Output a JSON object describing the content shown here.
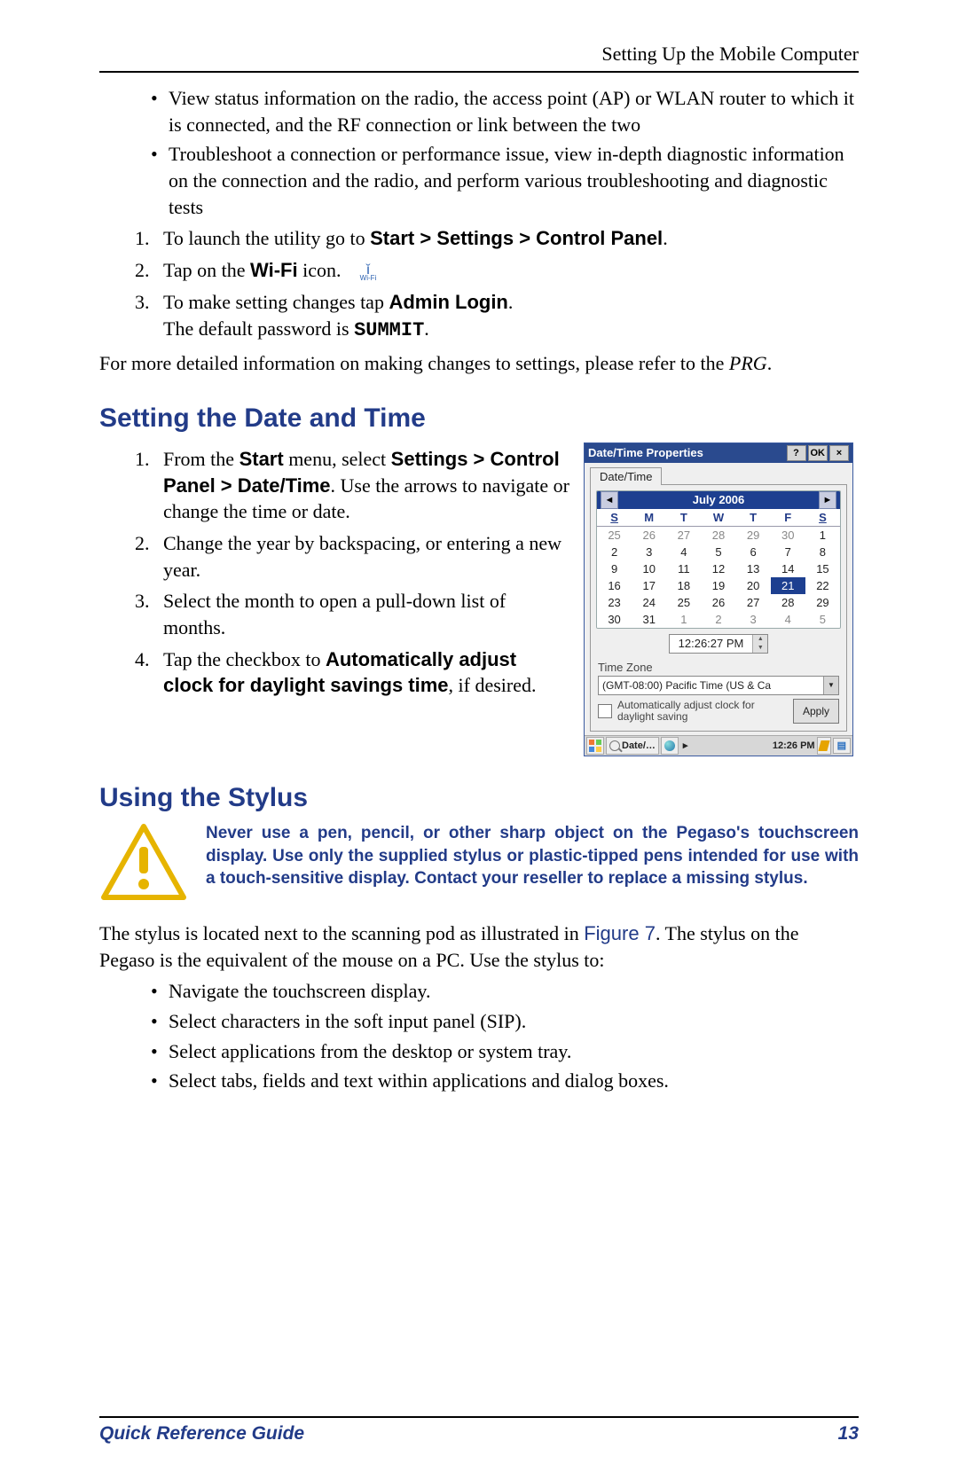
{
  "header": {
    "title": "Setting Up the Mobile Computer"
  },
  "intro_bullets": [
    "View status information on the radio, the access point (AP) or WLAN router to which it is connected, and the RF connection or link between the two",
    "Troubleshoot a connection or performance issue, view in-depth diagnostic information on the connection and the radio, and perform various troubleshooting and diagnostic tests"
  ],
  "steps_wifi": {
    "s1_pre": "To launch the utility go to ",
    "s1_path": "Start > Settings > Control Panel",
    "s2_pre": "Tap on the ",
    "s2_bold": "Wi-Fi",
    "s2_post": " icon.",
    "wifi_label": "Wi-Fi",
    "s3_pre": "To make setting changes tap ",
    "s3_bold": "Admin Login",
    "s3_post": ".",
    "s3_line2_pre": "The default password is ",
    "s3_code": "SUMMIT",
    "s3_line2_post": "."
  },
  "more_info": {
    "text": "For more detailed information on making changes to settings, please refer to the ",
    "ref": "PRG",
    "suffix": "."
  },
  "h_date": "Setting the Date and Time",
  "date_steps": {
    "s1_a": "From the ",
    "s1_b": "Start",
    "s1_c": " menu, select ",
    "s1_d": "Settings > Control Panel > Date/Time",
    "s1_e": ". Use the arrows to navigate or change the time or date.",
    "s2": "Change the year by backspacing, or entering a new year.",
    "s3": "Select the month to open a pull-down list of months.",
    "s4_a": "Tap the checkbox to ",
    "s4_b": "Automatically adjust clock for daylight savings time",
    "s4_c": ", if desired."
  },
  "dt_window": {
    "title": "Date/Time Properties",
    "help": "?",
    "ok": "OK",
    "close": "×",
    "tab": "Date/Time",
    "month": "July 2006",
    "nav_prev": "◄",
    "nav_next": "►",
    "dow": [
      "S",
      "M",
      "T",
      "W",
      "T",
      "F",
      "S"
    ],
    "weeks": [
      [
        {
          "d": "25",
          "o": true
        },
        {
          "d": "26",
          "o": true
        },
        {
          "d": "27",
          "o": true
        },
        {
          "d": "28",
          "o": true
        },
        {
          "d": "29",
          "o": true
        },
        {
          "d": "30",
          "o": true
        },
        {
          "d": "1"
        }
      ],
      [
        {
          "d": "2"
        },
        {
          "d": "3"
        },
        {
          "d": "4"
        },
        {
          "d": "5"
        },
        {
          "d": "6"
        },
        {
          "d": "7"
        },
        {
          "d": "8"
        }
      ],
      [
        {
          "d": "9"
        },
        {
          "d": "10"
        },
        {
          "d": "11"
        },
        {
          "d": "12"
        },
        {
          "d": "13"
        },
        {
          "d": "14"
        },
        {
          "d": "15"
        }
      ],
      [
        {
          "d": "16"
        },
        {
          "d": "17"
        },
        {
          "d": "18"
        },
        {
          "d": "19"
        },
        {
          "d": "20"
        },
        {
          "d": "21",
          "sel": true
        },
        {
          "d": "22"
        }
      ],
      [
        {
          "d": "23"
        },
        {
          "d": "24"
        },
        {
          "d": "25"
        },
        {
          "d": "26"
        },
        {
          "d": "27"
        },
        {
          "d": "28"
        },
        {
          "d": "29"
        }
      ],
      [
        {
          "d": "30"
        },
        {
          "d": "31"
        },
        {
          "d": "1",
          "o": true
        },
        {
          "d": "2",
          "o": true
        },
        {
          "d": "3",
          "o": true
        },
        {
          "d": "4",
          "o": true
        },
        {
          "d": "5",
          "o": true
        }
      ]
    ],
    "time": "12:26:27 PM",
    "tz_label": "Time Zone",
    "tz_value": "(GMT-08:00) Pacific Time (US & Ca",
    "dst": "Automatically adjust clock for daylight saving",
    "apply": "Apply",
    "taskbar_app": "Date/…",
    "taskbar_sep": "▸",
    "taskbar_clock": "12:26 PM"
  },
  "h_stylus": "Using the Stylus",
  "warning": "Never use a pen, pencil, or other sharp object on the Pegaso's touchscreen display. Use only the supplied stylus or plastic-tipped pens intended for use with a touch-sensitive display. Contact your reseller to replace a missing stylus.",
  "stylus_intro": {
    "a": "The stylus is located next to the scanning pod as illustrated in ",
    "fig": "Figure 7",
    "b": ". The stylus on the Pegaso is the equivalent of the mouse on a PC. Use the stylus to:"
  },
  "stylus_bullets": [
    "Navigate the touchscreen display.",
    "Select characters in the soft input panel (SIP).",
    "Select applications from the desktop or system tray.",
    "Select tabs, fields and text within applications and dialog boxes."
  ],
  "footer": {
    "guide": "Quick Reference Guide",
    "page": "13"
  }
}
